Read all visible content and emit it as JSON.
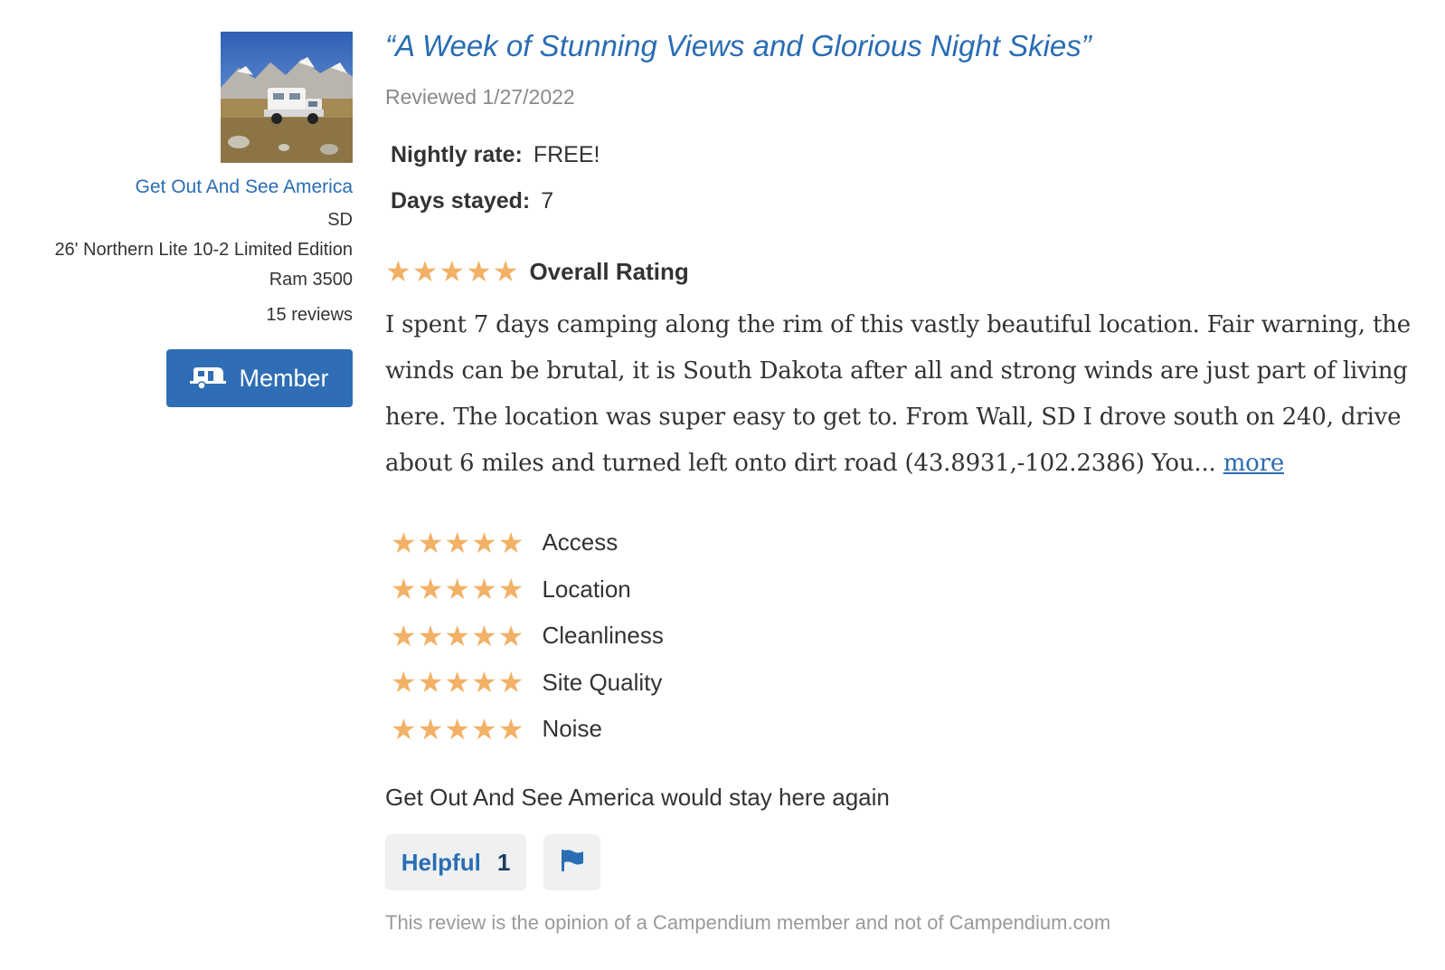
{
  "reviewer": {
    "avatar_icon": "rv-camper-photo",
    "name": "Get Out And See America",
    "state": "SD",
    "rig_line1": "26' Northern Lite 10-2 Limited Edition",
    "rig_line2": "Ram 3500",
    "review_count": "15 reviews",
    "badge_label": "Member",
    "badge_icon": "trailer-icon"
  },
  "review": {
    "title": "“A Week of Stunning Views and Glorious Night Skies”",
    "date": "Reviewed 1/27/2022",
    "nightly_rate_label": "Nightly rate:",
    "nightly_rate_value": "FREE!",
    "days_stayed_label": "Days stayed:",
    "days_stayed_value": "7",
    "overall_rating": 5,
    "overall_label": "Overall Rating",
    "body": "I spent 7 days camping along the rim of this vastly beautiful location. Fair warning, the winds can be brutal, it is South Dakota after all and strong winds are just part of living here. The location was super easy to get to. From Wall, SD I drove south on 240, drive about 6 miles and turned left onto dirt road (43.8931,-102.2386) You... ",
    "more_label": "more",
    "sub_ratings": [
      {
        "label": "Access",
        "rating": 5
      },
      {
        "label": "Location",
        "rating": 5
      },
      {
        "label": "Cleanliness",
        "rating": 5
      },
      {
        "label": "Site Quality",
        "rating": 5
      },
      {
        "label": "Noise",
        "rating": 5
      }
    ],
    "stay_again": "Get Out And See America would stay here again",
    "helpful_label": "Helpful",
    "helpful_count": "1",
    "flag_icon": "flag-icon",
    "disclaimer": "This review is the opinion of a Campendium member and not of Campendium.com"
  },
  "colors": {
    "link": "#2a6db3",
    "member_button": "#2f6eb4",
    "star": "#f2b166",
    "muted_text": "#8a8a8a",
    "button_bg": "#eef0f2"
  }
}
